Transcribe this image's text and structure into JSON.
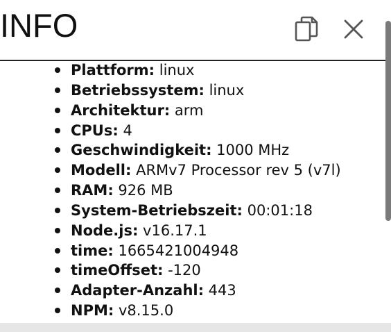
{
  "dialog": {
    "title": "INFO",
    "copy_icon": "copy-icon",
    "close_icon": "close-icon"
  },
  "info": [
    {
      "label": "Plattform:",
      "value": "linux"
    },
    {
      "label": "Betriebssystem:",
      "value": "linux"
    },
    {
      "label": "Architektur:",
      "value": "arm"
    },
    {
      "label": "CPUs:",
      "value": "4"
    },
    {
      "label": "Geschwindigkeit:",
      "value": "1000 MHz"
    },
    {
      "label": "Modell:",
      "value": "ARMv7 Processor rev 5 (v7l)"
    },
    {
      "label": "RAM:",
      "value": "926 MB"
    },
    {
      "label": "System-Betriebszeit:",
      "value": "00:01:18"
    },
    {
      "label": "Node.js:",
      "value": "v16.17.1"
    },
    {
      "label": "time:",
      "value": "1665421004948"
    },
    {
      "label": "timeOffset:",
      "value": "-120"
    },
    {
      "label": "Adapter-Anzahl:",
      "value": "443"
    },
    {
      "label": "NPM:",
      "value": "v8.15.0"
    }
  ]
}
